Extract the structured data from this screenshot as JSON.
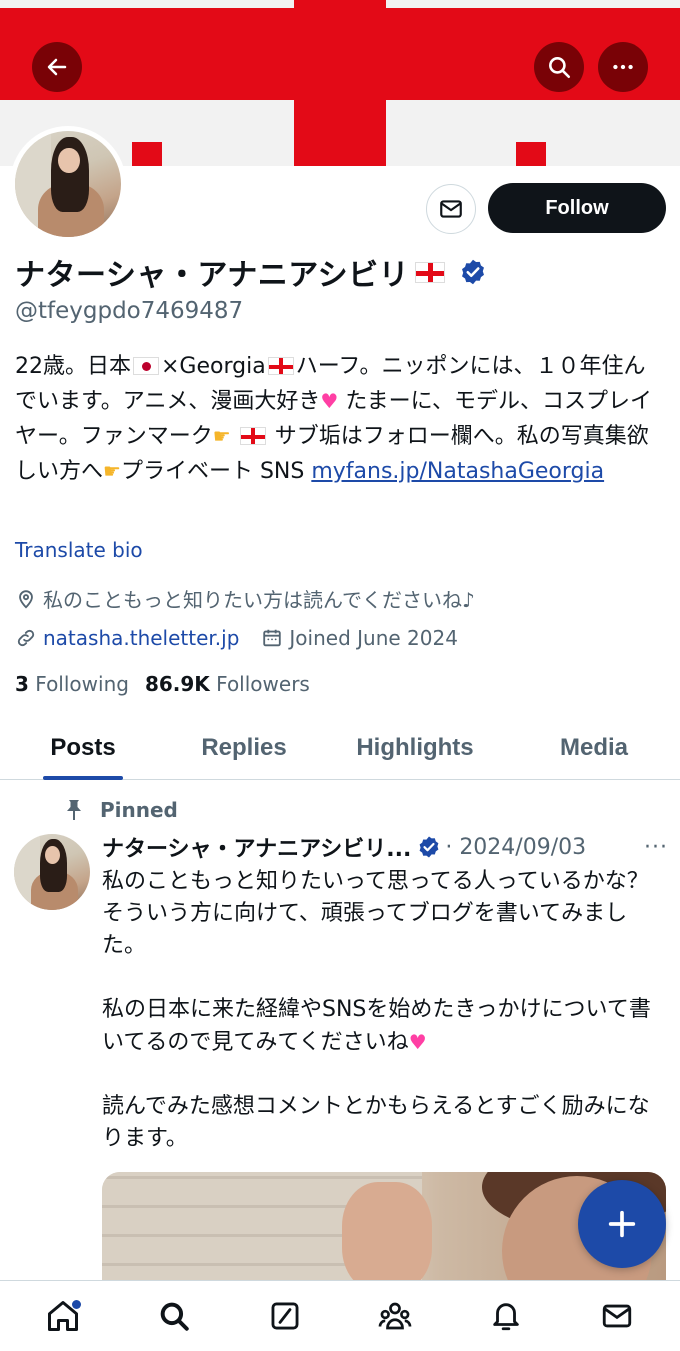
{
  "colors": {
    "accent": "#1d4aa8",
    "banner_red": "#e30a17",
    "text": "#0f1419",
    "muted": "#536471"
  },
  "header": {
    "back_icon": "arrow-left-icon",
    "search_icon": "search-icon",
    "more_icon": "more-icon"
  },
  "profile": {
    "name": "ナターシャ・アナニアシビリ",
    "handle": "@tfeygpdo7469487",
    "follow_label": "Follow",
    "bio": {
      "part1": "22歳。日本",
      "part2": "×Georgia",
      "part3": "ハーフ。ニッポンには、１０年住んでいます。アニメ、漫画大好き",
      "part4": "たまーに、モデル、コスプレイヤー。ファンマーク",
      "part5": "サブ垢はフォロー欄へ。私の写真集欲しい方へ",
      "part6": "プライベート SNS ",
      "link": "myfans.jp/NatashaGeorgia"
    },
    "translate_label": "Translate bio",
    "location": "私のこともっと知りたい方は読んでくださいね♪",
    "website": "natasha.theletter.jp",
    "joined": "Joined June 2024",
    "following_count": "3",
    "following_label": "Following",
    "followers_count": "86.9K",
    "followers_label": "Followers"
  },
  "tabs": [
    {
      "label": "Posts"
    },
    {
      "label": "Replies"
    },
    {
      "label": "Highlights"
    },
    {
      "label": "Media"
    }
  ],
  "post": {
    "pinned_label": "Pinned",
    "author": "ナターシャ・アナニアシビリ...",
    "date": "· 2024/09/03",
    "more": "···",
    "para1": "私のこともっと知りたいって思ってる人っているかな？ そういう方に向けて、頑張ってブログを書いてみました。",
    "para2": "私の日本に来た経緯やSNSを始めたきっかけについて書いてるので見てみてくださいね",
    "para3": "読んでみた感想コメントとかもらえるとすごく励みになります。"
  },
  "bottom_nav": [
    "home-icon",
    "search-icon",
    "grok-icon",
    "communities-icon",
    "notifications-icon",
    "messages-icon"
  ]
}
